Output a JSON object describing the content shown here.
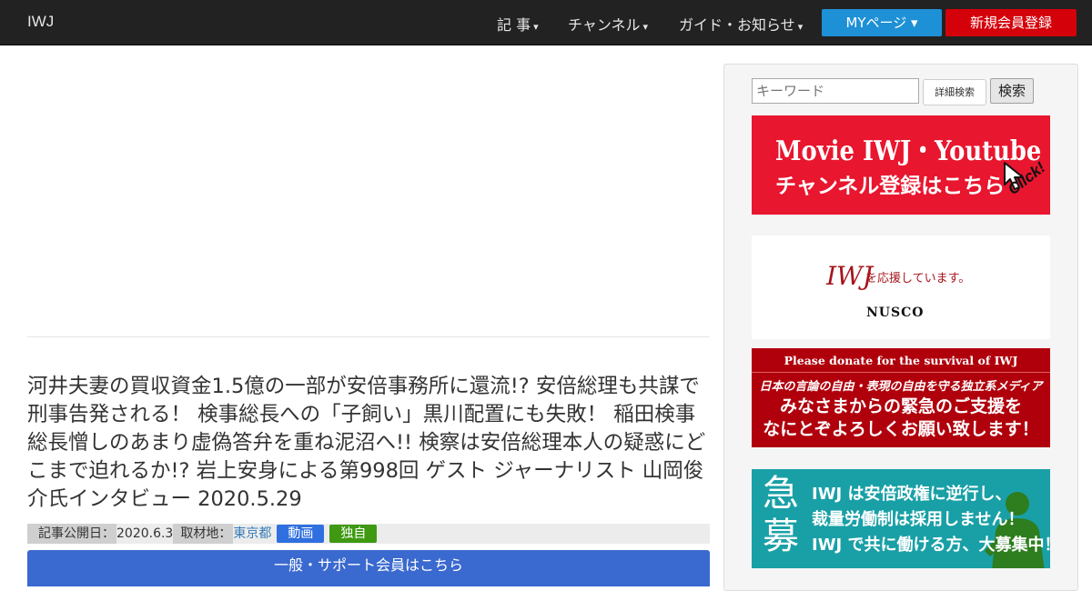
{
  "navbar": {
    "brand": "IWJ",
    "items": [
      {
        "label": "記 事",
        "caret": "▾"
      },
      {
        "label": "チャンネル",
        "caret": "▾"
      },
      {
        "label": "ガイド・お知らせ",
        "caret": "▾"
      }
    ],
    "my_page": "MYページ ▾",
    "register": "新規会員登録"
  },
  "article": {
    "title": "河井夫妻の買収資金1.5億の一部が安倍事務所に還流!? 安倍総理も共謀で刑事告発される！ 検事総長への「子飼い」黒川配置にも失敗！ 稲田検事総長憎しのあまり虚偽答弁を重ね泥沼へ!! 検察は安倍総理本人の疑惑にどこまで迫れるか!? 岩上安身による第998回 ゲスト ジャーナリスト 山岡俊介氏インタビュー 2020.5.29",
    "published_label": "記事公開日：",
    "published_date": "2020.6.3",
    "location_label": "取材地：",
    "location": "東京都",
    "tags": [
      "動画",
      "独自"
    ],
    "member_button": "一般・サポート会員はこちら"
  },
  "sidebar": {
    "search_placeholder": "キーワード",
    "advanced_search": "詳細検索",
    "search_button": "検索",
    "youtube_banner": {
      "line1": "Movie IWJ・Youtube",
      "line2": "チャンネル登録はこちら",
      "click": "Click!"
    },
    "nusco_banner": {
      "iwj": "IWJ",
      "support": "を応援しています。",
      "brand": "NUSCO"
    },
    "donate_banner": {
      "line1": "Please donate for the survival of IWJ",
      "line2": "日本の言論の自由・表現の自由を守る独立系メディア",
      "line3": "みなさまからの緊急のご支援を",
      "line4": "なにとぞよろしくお願い致します！"
    },
    "recruit_banner": {
      "kyubo": "急募",
      "line1": "IWJ は安倍政権に逆行し、",
      "line2": "裁量労働制は採用しません！",
      "line3": "IWJ で共に働ける方、大募集中！"
    }
  },
  "colors": {
    "navbar": "#222222",
    "my_page": "#1e90d6",
    "register": "#d4000a",
    "member_button": "#3a69cf",
    "tag_video": "#2f6fe0",
    "tag_exclusive": "#3f9a12"
  }
}
